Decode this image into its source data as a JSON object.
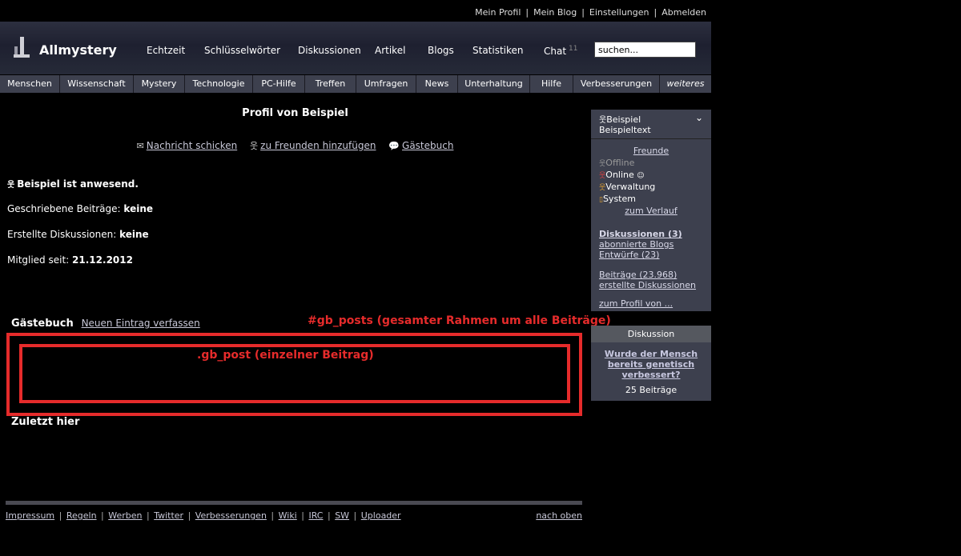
{
  "userbar": {
    "items": [
      "Mein Profil",
      "Mein Blog",
      "Einstellungen",
      "Abmelden"
    ]
  },
  "header": {
    "logo": "Allmystery",
    "nav": [
      {
        "label": "Echtzeit"
      },
      {
        "label": "Schlüsselwörter"
      },
      {
        "label": "Diskussionen"
      },
      {
        "label": "Artikel"
      },
      {
        "label": "Blogs"
      },
      {
        "label": "Statistiken"
      },
      {
        "label": "Chat",
        "badge": "11"
      }
    ],
    "search_value": "suchen..."
  },
  "categories": [
    "Menschen",
    "Wissenschaft",
    "Mystery",
    "Technologie",
    "PC-Hilfe",
    "Treffen",
    "Umfragen",
    "News",
    "Unterhaltung",
    "Hilfe",
    "Verbesserungen",
    "weiteres"
  ],
  "profile": {
    "title": "Profil von Beispiel",
    "actions": {
      "message": "Nachricht schicken",
      "add_friend": "zu Freunden hinzufügen",
      "guestbook": "Gästebuch"
    },
    "presence": "Beispiel ist anwesend.",
    "stats": [
      {
        "label": "Geschriebene Beiträge:",
        "value": "keine"
      },
      {
        "label": "Erstellte Diskussionen:",
        "value": "keine"
      },
      {
        "label": "Mitglied seit:",
        "value": "21.12.2012"
      }
    ]
  },
  "guestbook": {
    "title": "Gästebuch",
    "new_entry": "Neuen Eintrag verfassen",
    "posts_annotation": "#gb_posts (gesamter Rahmen um alle Beiträge)",
    "post_annotation": ".gb_post (einzelner Beitrag)"
  },
  "last_here": "Zuletzt hier",
  "footer": {
    "links": [
      "Impressum",
      "Regeln",
      "Werben",
      "Twitter",
      "Verbesserungen",
      "Wiki",
      "IRC",
      "SW",
      "Uploader"
    ],
    "top": "nach oben"
  },
  "sidebar": {
    "user_name": "Beispiel",
    "user_text": "Beispieltext",
    "friends": "Freunde",
    "statuses": [
      {
        "label": "Offline",
        "color": "#999999"
      },
      {
        "label": "Online",
        "color": "#ffffff"
      },
      {
        "label": "Verwaltung",
        "color": "#ffffff"
      },
      {
        "label": "System",
        "color": "#ffffff"
      }
    ],
    "history": "zum Verlauf",
    "discussions": "Diskussionen (3)",
    "subscribed_blogs": "abonnierte Blogs",
    "drafts": "Entwürfe (23)",
    "posts": "Beiträge (23.968)",
    "created_discussions": "erstellte Diskussionen",
    "profile_of": "zum Profil von ...",
    "box2_head": "Diskussion",
    "box2_topic": "Wurde der Mensch bereits genetisch verbessert?",
    "box2_count": "25 Beiträge"
  }
}
